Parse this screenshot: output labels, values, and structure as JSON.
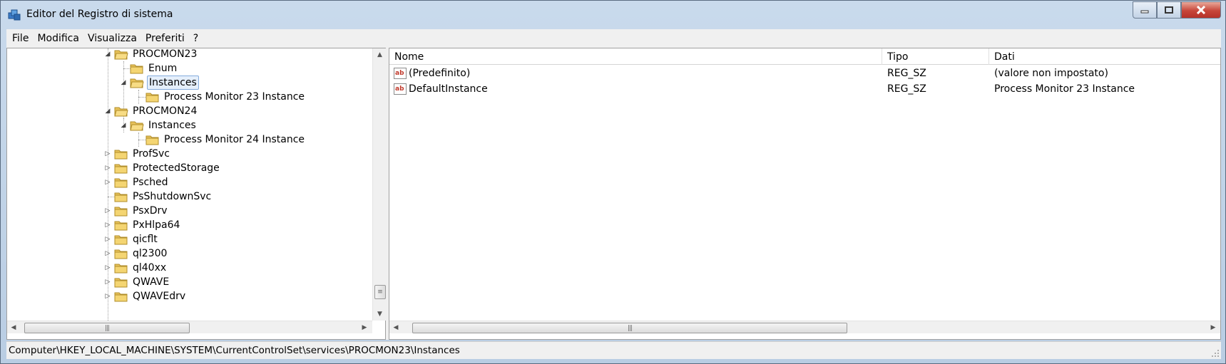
{
  "window": {
    "title": "Editor del Registro di sistema"
  },
  "menu": [
    {
      "label": "File"
    },
    {
      "label": "Modifica"
    },
    {
      "label": "Visualizza"
    },
    {
      "label": "Preferiti"
    },
    {
      "label": "?"
    }
  ],
  "tree": {
    "items": [
      {
        "label": "PROCMON23"
      },
      {
        "label": "Enum"
      },
      {
        "label": "Instances"
      },
      {
        "label": "Process Monitor 23 Instance"
      },
      {
        "label": "PROCMON24"
      },
      {
        "label": "Instances"
      },
      {
        "label": "Process Monitor 24 Instance"
      },
      {
        "label": "ProfSvc"
      },
      {
        "label": "ProtectedStorage"
      },
      {
        "label": "Psched"
      },
      {
        "label": "PsShutdownSvc"
      },
      {
        "label": "PsxDrv"
      },
      {
        "label": "PxHlpa64"
      },
      {
        "label": "qicflt"
      },
      {
        "label": "ql2300"
      },
      {
        "label": "ql40xx"
      },
      {
        "label": "QWAVE"
      },
      {
        "label": "QWAVEdrv"
      }
    ]
  },
  "list": {
    "columns": [
      {
        "label": "Nome"
      },
      {
        "label": "Tipo"
      },
      {
        "label": "Dati"
      }
    ],
    "rows": [
      {
        "name": "(Predefinito)",
        "type": "REG_SZ",
        "data": "(valore non impostato)"
      },
      {
        "name": "DefaultInstance",
        "type": "REG_SZ",
        "data": "Process Monitor 23 Instance"
      }
    ]
  },
  "status": {
    "path": "Computer\\HKEY_LOCAL_MACHINE\\SYSTEM\\CurrentControlSet\\services\\PROCMON23\\Instances"
  },
  "colors": {
    "folder": "#e8c25a",
    "selection_border": "#84acdd",
    "selection_fill": "#e5effb",
    "close_button": "#c7463a"
  }
}
